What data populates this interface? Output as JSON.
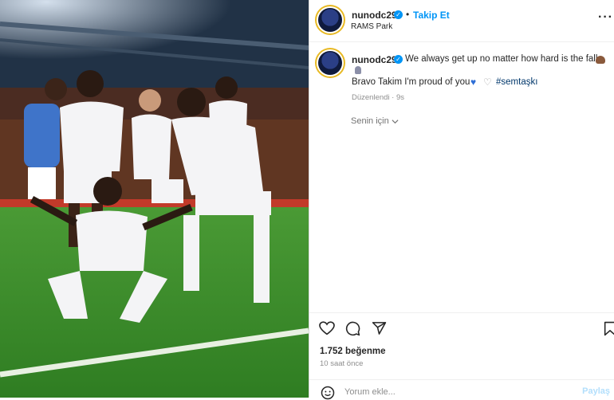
{
  "post": {
    "username": "nunodc29",
    "dot": "•",
    "follow_label": "Takip Et",
    "location": "RAMS Park",
    "more_label": "···"
  },
  "caption": {
    "username": "nunodc29",
    "line1": "We always get up no matter how hard is the fall",
    "line2": "Bravo Takim I'm proud of you",
    "hashtag": "#semtaşkı",
    "edited": "Düzenlendi · 9s",
    "translate_label": "Senin için"
  },
  "engagement": {
    "likes": "1.752 beğenme",
    "time": "10 saat önce"
  },
  "comment": {
    "placeholder": "Yorum ekle...",
    "share_label": "Paylaş"
  },
  "icons": {
    "like": "heart-icon",
    "comment": "comment-icon",
    "share": "send-icon",
    "save": "bookmark-icon",
    "emoji": "emoji-icon",
    "more": "more-icon",
    "verified": "verified-badge-icon",
    "translate_chevron": "chevron-down-icon"
  },
  "colors": {
    "accent": "#0095f6",
    "text": "#262626",
    "muted": "#8e8e8e",
    "hashtag": "#00376b"
  }
}
